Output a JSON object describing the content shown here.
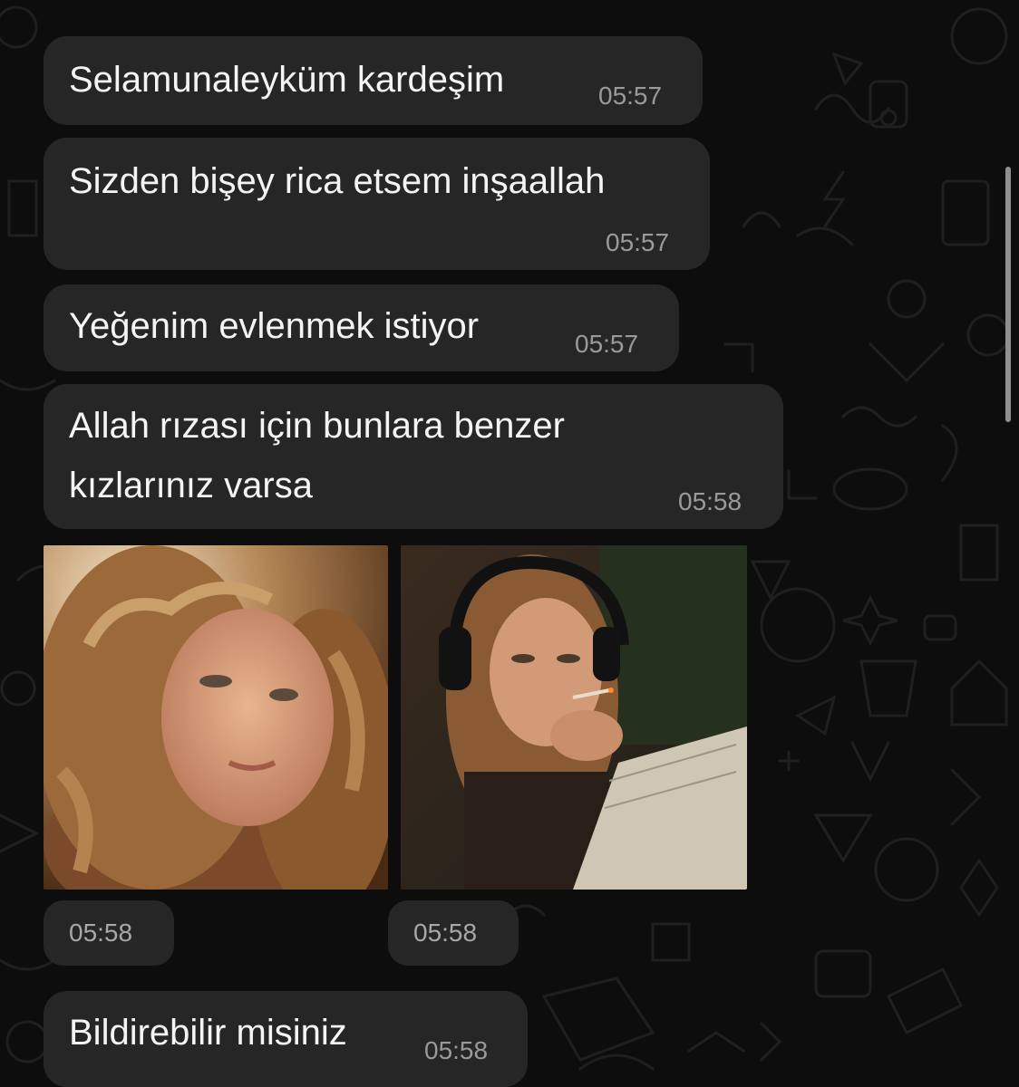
{
  "messages": [
    {
      "text": "Selamunaleyküm kardeşim",
      "time": "05:57"
    },
    {
      "text": "Sizden bişey rica etsem inşaallah",
      "time": "05:57"
    },
    {
      "text": "Yeğenim evlenmek istiyor",
      "time": "05:57"
    },
    {
      "text_line1": "Allah rızası için bunlara benzer",
      "text_line2": "kızlarınız varsa",
      "time": "05:58"
    },
    {
      "text": "Bildirebilir misiniz",
      "time": "05:58"
    }
  ],
  "photos": [
    {
      "time": "05:58"
    },
    {
      "time": "05:58"
    }
  ],
  "colors": {
    "background": "#0d0d0d",
    "bubble": "#262626",
    "text": "#f4f4f4",
    "timestamp": "#9a9a9a"
  }
}
